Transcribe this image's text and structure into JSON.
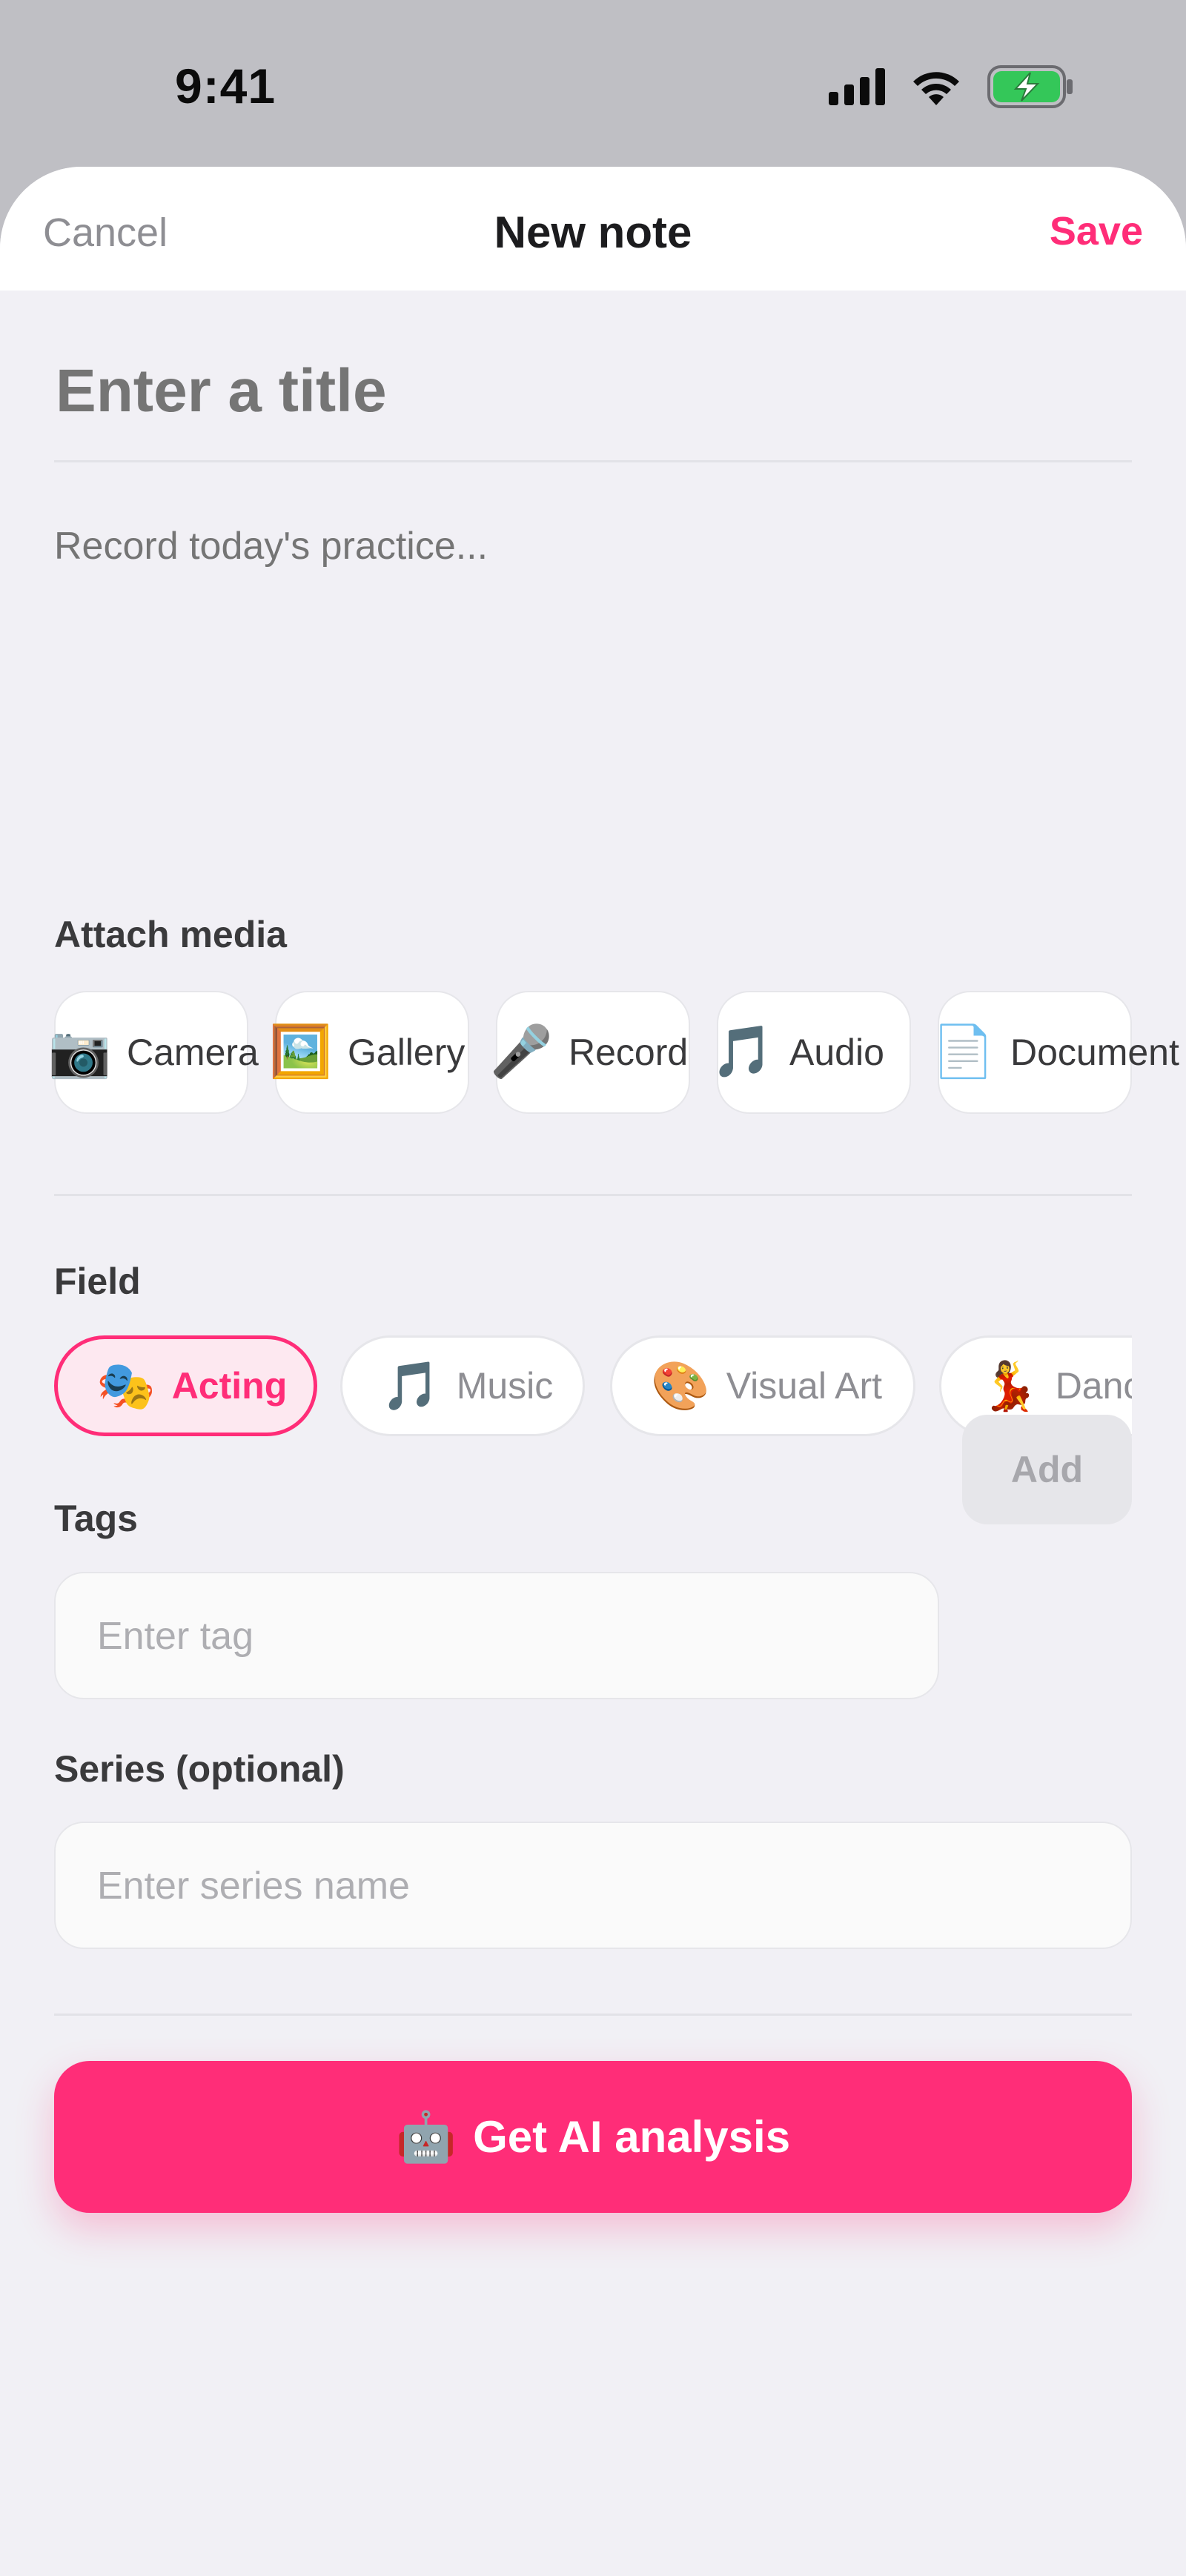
{
  "status_bar": {
    "time": "9:41"
  },
  "nav": {
    "cancel": "Cancel",
    "title": "New note",
    "save": "Save"
  },
  "form": {
    "title_placeholder": "Enter a title",
    "body_placeholder": "Record today's practice..."
  },
  "attach_media": {
    "label": "Attach media",
    "items": [
      {
        "emoji": "📷",
        "label": "Camera",
        "icon": "camera-icon"
      },
      {
        "emoji": "🖼️",
        "label": "Gallery",
        "icon": "gallery-icon"
      },
      {
        "emoji": "🎤",
        "label": "Record",
        "icon": "microphone-icon"
      },
      {
        "emoji": "🎵",
        "label": "Audio",
        "icon": "music-note-icon"
      },
      {
        "emoji": "📄",
        "label": "Document",
        "icon": "document-icon"
      }
    ]
  },
  "field": {
    "label": "Field",
    "options": [
      {
        "emoji": "🎭",
        "label": "Acting",
        "selected": true
      },
      {
        "emoji": "🎵",
        "label": "Music",
        "selected": false
      },
      {
        "emoji": "🎨",
        "label": "Visual Art",
        "selected": false
      },
      {
        "emoji": "💃",
        "label": "Dance",
        "selected": false
      }
    ]
  },
  "tags": {
    "label": "Tags",
    "placeholder": "Enter tag",
    "add_label": "Add"
  },
  "series": {
    "label": "Series (optional)",
    "placeholder": "Enter series name"
  },
  "ai_button": {
    "emoji": "🤖",
    "label": "Get AI analysis"
  },
  "colors": {
    "accent": "#ff2d78",
    "battery": "#34c759"
  }
}
